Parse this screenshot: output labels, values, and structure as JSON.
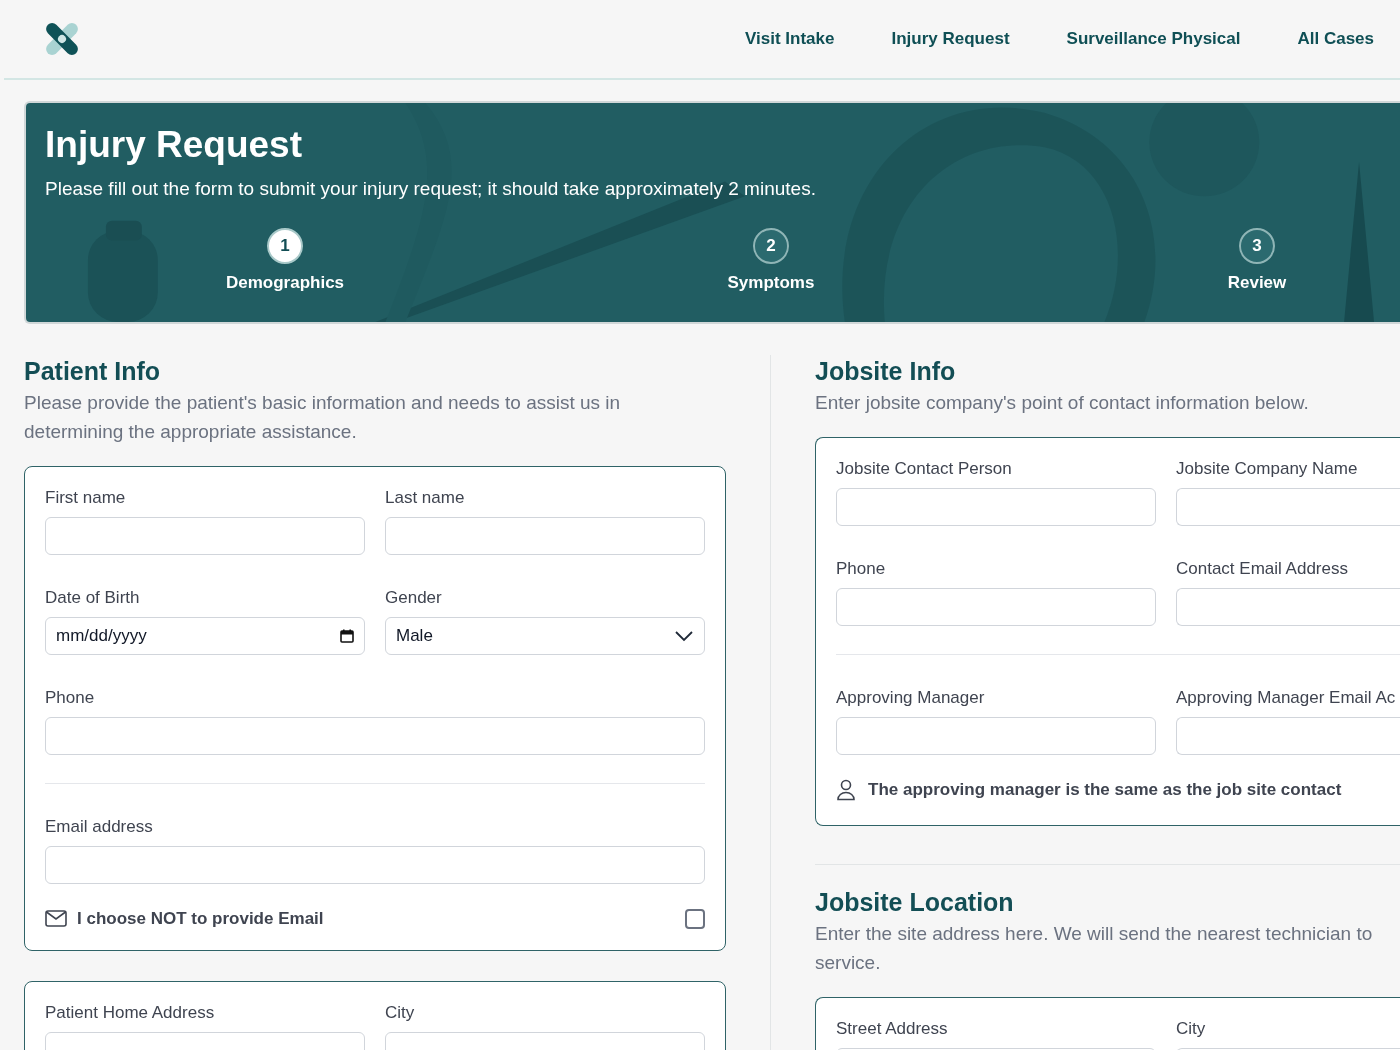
{
  "nav": {
    "links": [
      {
        "label": "Visit Intake"
      },
      {
        "label": "Injury Request"
      },
      {
        "label": "Surveillance Physical"
      },
      {
        "label": "All Cases"
      }
    ]
  },
  "hero": {
    "title": "Injury Request",
    "subtitle": "Please fill out the form to submit your injury request; it should take approximately 2 minutes.",
    "steps": [
      {
        "number": "1",
        "label": "Demographics",
        "selected": true
      },
      {
        "number": "2",
        "label": "Symptoms",
        "selected": false
      },
      {
        "number": "3",
        "label": "Review",
        "selected": false
      }
    ]
  },
  "patient_info": {
    "title": "Patient Info",
    "description": "Please provide the patient's basic information and needs to assist us in determining the appropriate assistance.",
    "cards": [
      {
        "sections": [
          {
            "rows": [
              [
                {
                  "kind": "text",
                  "label": "First name"
                },
                {
                  "kind": "text",
                  "label": "Last name"
                }
              ],
              [
                {
                  "kind": "date",
                  "label": "Date of Birth",
                  "placeholder": "mm/dd/yyyy"
                },
                {
                  "kind": "select",
                  "label": "Gender",
                  "value": "Male"
                }
              ],
              [
                {
                  "kind": "text",
                  "label": "Phone"
                }
              ]
            ]
          },
          {
            "rows": [
              [
                {
                  "kind": "text",
                  "label": "Email address"
                }
              ]
            ]
          }
        ],
        "checkbox": {
          "label": "I choose NOT to provide Email",
          "checked": false
        }
      },
      {
        "sections": [
          {
            "rows": [
              [
                {
                  "kind": "text",
                  "label": "Patient Home Address"
                },
                {
                  "kind": "text",
                  "label": "City"
                }
              ]
            ]
          }
        ]
      }
    ]
  },
  "jobsite_info": {
    "title": "Jobsite Info",
    "description": "Enter jobsite company's point of contact information below.",
    "cards": [
      {
        "sections": [
          {
            "rows": [
              [
                {
                  "kind": "text",
                  "label": "Jobsite Contact Person"
                },
                {
                  "kind": "text",
                  "label": "Jobsite Company Name"
                }
              ],
              [
                {
                  "kind": "text",
                  "label": "Phone"
                },
                {
                  "kind": "text",
                  "label": "Contact Email Address"
                }
              ]
            ]
          },
          {
            "rows": [
              [
                {
                  "kind": "text",
                  "label": "Approving Manager"
                },
                {
                  "kind": "text",
                  "label": "Approving Manager Email Ac"
                }
              ]
            ]
          }
        ],
        "note": "The approving manager is the same as the job site contact"
      }
    ]
  },
  "jobsite_location": {
    "title": "Jobsite Location",
    "description": "Enter the site address here. We will send the nearest technician to service.",
    "cards": [
      {
        "sections": [
          {
            "rows": [
              [
                {
                  "kind": "text",
                  "label": "Street Address"
                },
                {
                  "kind": "text",
                  "label": "City"
                }
              ]
            ]
          }
        ]
      }
    ]
  }
}
